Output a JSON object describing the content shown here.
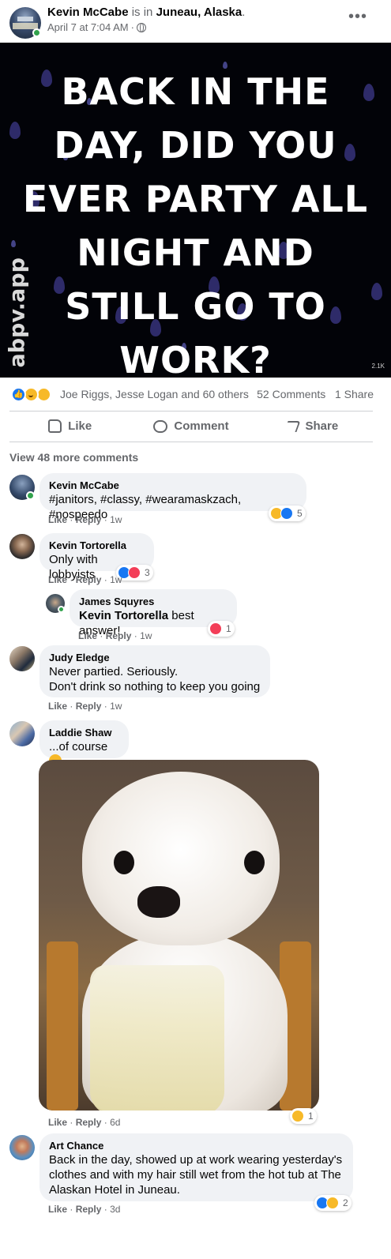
{
  "post": {
    "author": "Kevin McCabe",
    "is_in": "is in",
    "location": "Juneau, Alaska",
    "period": ".",
    "timestamp": "April 7 at 7:04 AM",
    "dot": "·",
    "more": "•••"
  },
  "meme": {
    "lines": [
      "BACK IN THE",
      "DAY, DID YOU",
      "EVER PARTY ALL",
      "NIGHT AND",
      "STILL GO TO",
      "WORK?"
    ],
    "watermark": "abpv.app",
    "views": "2.1K"
  },
  "stats": {
    "reactors": "Joe Riggs, Jesse Logan and 60 others",
    "comments": "52 Comments",
    "shares": "1 Share"
  },
  "actions": {
    "like": "Like",
    "comment": "Comment",
    "share": "Share"
  },
  "view_more": "View 48 more comments",
  "comments": [
    {
      "name": "Kevin McCabe",
      "text": "#janitors, #classy, #wearamaskzach, #nospeedo",
      "like": "Like",
      "reply": "Reply",
      "age": "1w",
      "reaction_count": "5"
    },
    {
      "name": "Kevin Tortorella",
      "text": "Only with lobbyists",
      "like": "Like",
      "reply": "Reply",
      "age": "1w",
      "reaction_count": "3"
    },
    {
      "name": "James Squyres",
      "mention": "Kevin Tortorella",
      "text": " best answer!",
      "like": "Like",
      "reply": "Reply",
      "age": "1w",
      "reaction_count": "1"
    },
    {
      "name": "Judy Eledge",
      "text_line1": "Never partied. Seriously.",
      "text_line2": "Don't drink so nothing to keep you going",
      "like": "Like",
      "reply": "Reply",
      "age": "1w"
    },
    {
      "name": "Laddie Shaw",
      "text": "...of course",
      "like": "Like",
      "reply": "Reply",
      "age": "6d",
      "reaction_count": "1"
    },
    {
      "name": "Art Chance",
      "text_line1": "Back in the day, showed up at work wearing yesterday's",
      "text_line2": "clothes and with my hair still wet from the hot tub at The",
      "text_line3": "Alaskan Hotel in Juneau.",
      "like": "Like",
      "reply": "Reply",
      "age": "3d",
      "reaction_count": "2"
    }
  ],
  "separator": "·",
  "colors": {
    "like_blue": "#1877f2",
    "haha_yellow": "#f7b928",
    "love_red": "#f33e58",
    "online_green": "#31a24c",
    "muted_gray": "#65676b",
    "bubble_gray": "#f0f2f5"
  },
  "icons": [
    "globe-icon",
    "more-icon",
    "like-icon",
    "comment-icon",
    "share-icon",
    "like-reaction-icon",
    "haha-reaction-icon",
    "wow-reaction-icon",
    "love-reaction-icon",
    "smile-emoji-icon"
  ]
}
